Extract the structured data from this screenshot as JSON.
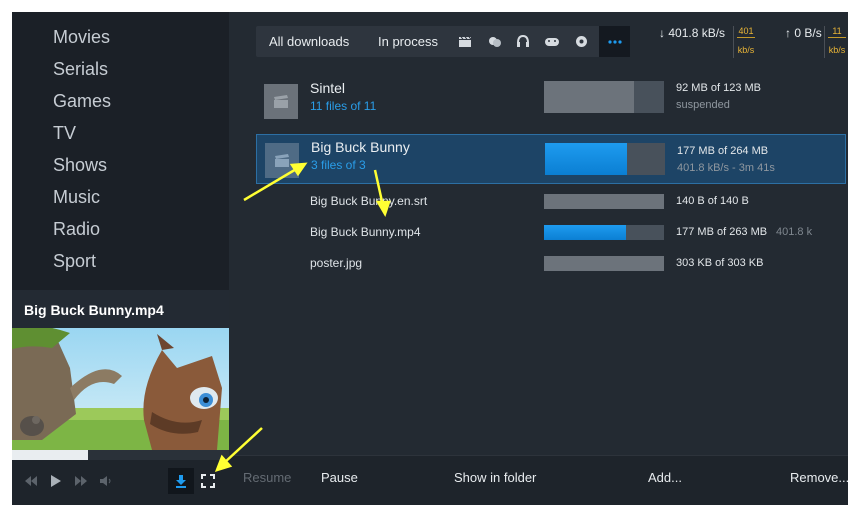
{
  "sidebar": {
    "categories": [
      "Movies",
      "Serials",
      "Games",
      "TV",
      "Shows",
      "Music",
      "Radio",
      "Sport"
    ]
  },
  "player": {
    "title": "Big Buck Bunny.mp4",
    "seek_progress": 0.35
  },
  "filters": {
    "all_label": "All downloads",
    "in_process_label": "In process",
    "icons": [
      "film-icon",
      "theater-masks-icon",
      "headphones-icon",
      "gamepad-icon",
      "soccer-ball-icon",
      "more-icon"
    ]
  },
  "speeds": {
    "download": "401.8 kB/s",
    "download_meter_value": "401",
    "download_meter_unit": "kb/s",
    "upload": "0 B/s",
    "upload_meter_value": "11",
    "upload_meter_unit": "kb/s"
  },
  "downloads": [
    {
      "name": "Sintel",
      "files": "11 files of 11",
      "size": "92 MB of 123 MB",
      "status": "suspended",
      "progress": 0.75,
      "active": false
    },
    {
      "name": "Big Buck Bunny",
      "files": "3 files of 3",
      "size": "177 MB of 264 MB",
      "status": "401.8 kB/s - 3m 41s",
      "progress": 0.68,
      "active": true,
      "children": [
        {
          "name": "Big Buck Bunny.en.srt",
          "size": "140 B of 140 B",
          "speed": "",
          "progress": 1.0,
          "active": false
        },
        {
          "name": "Big Buck Bunny.mp4",
          "size": "177 MB of 263 MB",
          "speed": "401.8 k",
          "progress": 0.68,
          "active": true
        },
        {
          "name": "poster.jpg",
          "size": "303 KB of 303 KB",
          "speed": "",
          "progress": 1.0,
          "active": false
        }
      ]
    }
  ],
  "actions": {
    "resume": "Resume",
    "pause": "Pause",
    "show_in_folder": "Show in folder",
    "add": "Add...",
    "remove": "Remove..."
  },
  "colors": {
    "accent": "#1e9bef",
    "selection": "#1d4466",
    "annotation_arrow": "#ffff33"
  }
}
